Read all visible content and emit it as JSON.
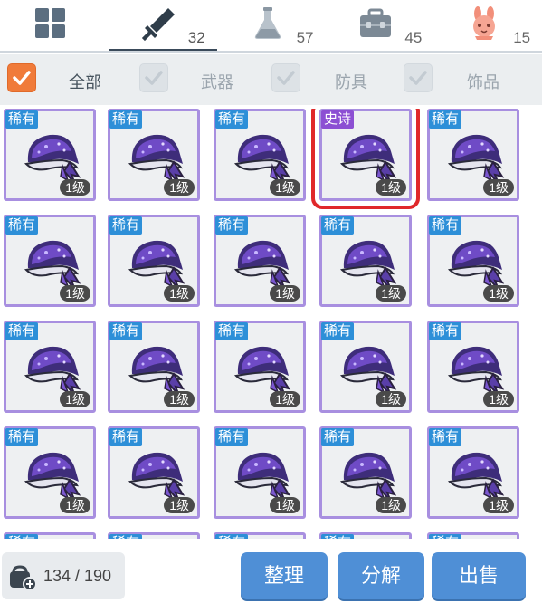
{
  "tabs": [
    {
      "icon": "grid-icon",
      "count": "",
      "active": false
    },
    {
      "icon": "sword-icon",
      "count": "32",
      "active": true
    },
    {
      "icon": "potion-flask-icon",
      "count": "57",
      "active": false
    },
    {
      "icon": "toolbox-icon",
      "count": "45",
      "active": false
    },
    {
      "icon": "pet-bunny-icon",
      "count": "15",
      "active": false
    }
  ],
  "filters": [
    {
      "label": "全部",
      "checked": true
    },
    {
      "label": "武器",
      "checked": false
    },
    {
      "label": "防具",
      "checked": false
    },
    {
      "label": "饰品",
      "checked": false
    }
  ],
  "items": [
    {
      "rarity": "稀有",
      "level": "1级"
    },
    {
      "rarity": "稀有",
      "level": "1级"
    },
    {
      "rarity": "稀有",
      "level": "1级"
    },
    {
      "rarity": "史诗",
      "level": "1级",
      "selected": true
    },
    {
      "rarity": "稀有",
      "level": "1级"
    },
    {
      "rarity": "稀有",
      "level": "1级"
    },
    {
      "rarity": "稀有",
      "level": "1级"
    },
    {
      "rarity": "稀有",
      "level": "1级"
    },
    {
      "rarity": "稀有",
      "level": "1级"
    },
    {
      "rarity": "稀有",
      "level": "1级"
    },
    {
      "rarity": "稀有",
      "level": "1级"
    },
    {
      "rarity": "稀有",
      "level": "1级"
    },
    {
      "rarity": "稀有",
      "level": "1级"
    },
    {
      "rarity": "稀有",
      "level": "1级"
    },
    {
      "rarity": "稀有",
      "level": "1级"
    },
    {
      "rarity": "稀有",
      "level": "1级"
    },
    {
      "rarity": "稀有",
      "level": "1级"
    },
    {
      "rarity": "稀有",
      "level": "1级"
    },
    {
      "rarity": "稀有",
      "level": "1级"
    },
    {
      "rarity": "稀有",
      "level": "1级"
    },
    {
      "rarity": "稀有",
      "level": ""
    },
    {
      "rarity": "稀有",
      "level": ""
    },
    {
      "rarity": "稀有",
      "level": ""
    },
    {
      "rarity": "稀有",
      "level": ""
    },
    {
      "rarity": "稀有",
      "level": ""
    }
  ],
  "item_icon": "bandana-icon",
  "colors": {
    "rare_badge": "#2d8fd8",
    "epic_badge": "#8c4fd3",
    "item_border": "#a88fe0",
    "selected_outline": "#e0282a",
    "accent_checkbox": "#f07b3a",
    "button": "#4f8fd6"
  },
  "capacity": {
    "icon": "bag-add-icon",
    "text": "134 / 190"
  },
  "buttons": {
    "sort": "整理",
    "dismantle": "分解",
    "sell": "出售"
  }
}
